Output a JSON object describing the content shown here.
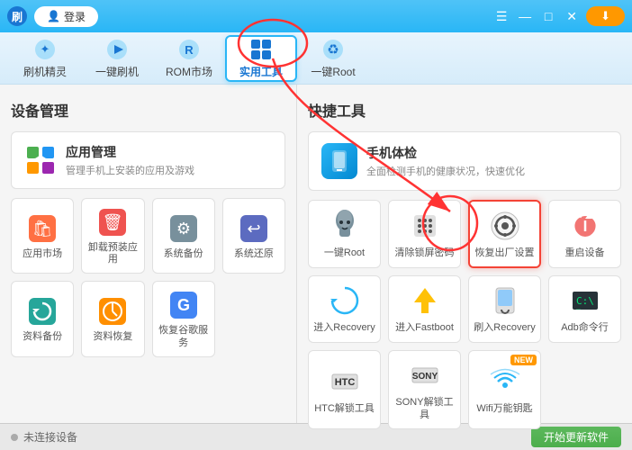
{
  "titleBar": {
    "login": "登录",
    "minimize": "—",
    "maximize": "□",
    "close": "✕"
  },
  "nav": {
    "items": [
      {
        "id": "brush",
        "label": "刷机精灵",
        "icon": "✦"
      },
      {
        "id": "onekey",
        "label": "一键刷机",
        "icon": "▶"
      },
      {
        "id": "rom",
        "label": "ROM市场",
        "icon": "R"
      },
      {
        "id": "tools",
        "label": "实用工具",
        "icon": "⊞",
        "active": true
      },
      {
        "id": "root",
        "label": "一键Root",
        "icon": "♻"
      }
    ]
  },
  "leftPanel": {
    "sectionTitle": "设备管理",
    "appManage": {
      "title": "应用管理",
      "desc": "管理手机上安装的应用及游戏"
    },
    "gridItems": [
      {
        "id": "appmarket",
        "label": "应用市场",
        "icon": "🛍"
      },
      {
        "id": "uninstall",
        "label": "卸载预装应用",
        "icon": "🗑"
      },
      {
        "id": "backup",
        "label": "系统备份",
        "icon": "⚙"
      },
      {
        "id": "restore",
        "label": "系统还原",
        "icon": "↩"
      },
      {
        "id": "databak",
        "label": "资料备份",
        "icon": "🔄"
      },
      {
        "id": "datarestore",
        "label": "资料恢复",
        "icon": "🕐"
      },
      {
        "id": "google",
        "label": "恢复谷歌服务",
        "icon": "G"
      }
    ]
  },
  "rightPanel": {
    "sectionTitle": "快捷工具",
    "phoneCheck": {
      "title": "手机体检",
      "desc": "全面检测手机的健康状况，快速优化"
    },
    "quickItems": [
      {
        "id": "oneroot",
        "label": "一键Root",
        "icon": "android",
        "highlighted": false
      },
      {
        "id": "clearlock",
        "label": "清除锁屏密码",
        "icon": "dots",
        "highlighted": false
      },
      {
        "id": "factoryreset",
        "label": "恢复出厂设置",
        "icon": "gear",
        "highlighted": true
      },
      {
        "id": "reboot",
        "label": "重启设备",
        "icon": "reboot",
        "highlighted": false
      },
      {
        "id": "recovery",
        "label": "进入Recovery",
        "icon": "recovery",
        "highlighted": false
      },
      {
        "id": "fastboot",
        "label": "进入Fastboot",
        "icon": "fastboot",
        "highlighted": false
      },
      {
        "id": "flashrecovery",
        "label": "刷入Recovery",
        "icon": "flash",
        "highlighted": false
      },
      {
        "id": "adb",
        "label": "Adb命令行",
        "icon": "adb",
        "highlighted": false
      },
      {
        "id": "htc",
        "label": "HTC解锁工具",
        "icon": "htc",
        "highlighted": false
      },
      {
        "id": "sony",
        "label": "SONY解锁工具",
        "icon": "sony",
        "highlighted": false
      },
      {
        "id": "wifi",
        "label": "Wifi万能钥匙",
        "icon": "wifi",
        "highlighted": false,
        "badge": "NEW"
      }
    ]
  },
  "statusBar": {
    "connectionStatus": "未连接设备",
    "updateBtn": "开始更新软件"
  }
}
